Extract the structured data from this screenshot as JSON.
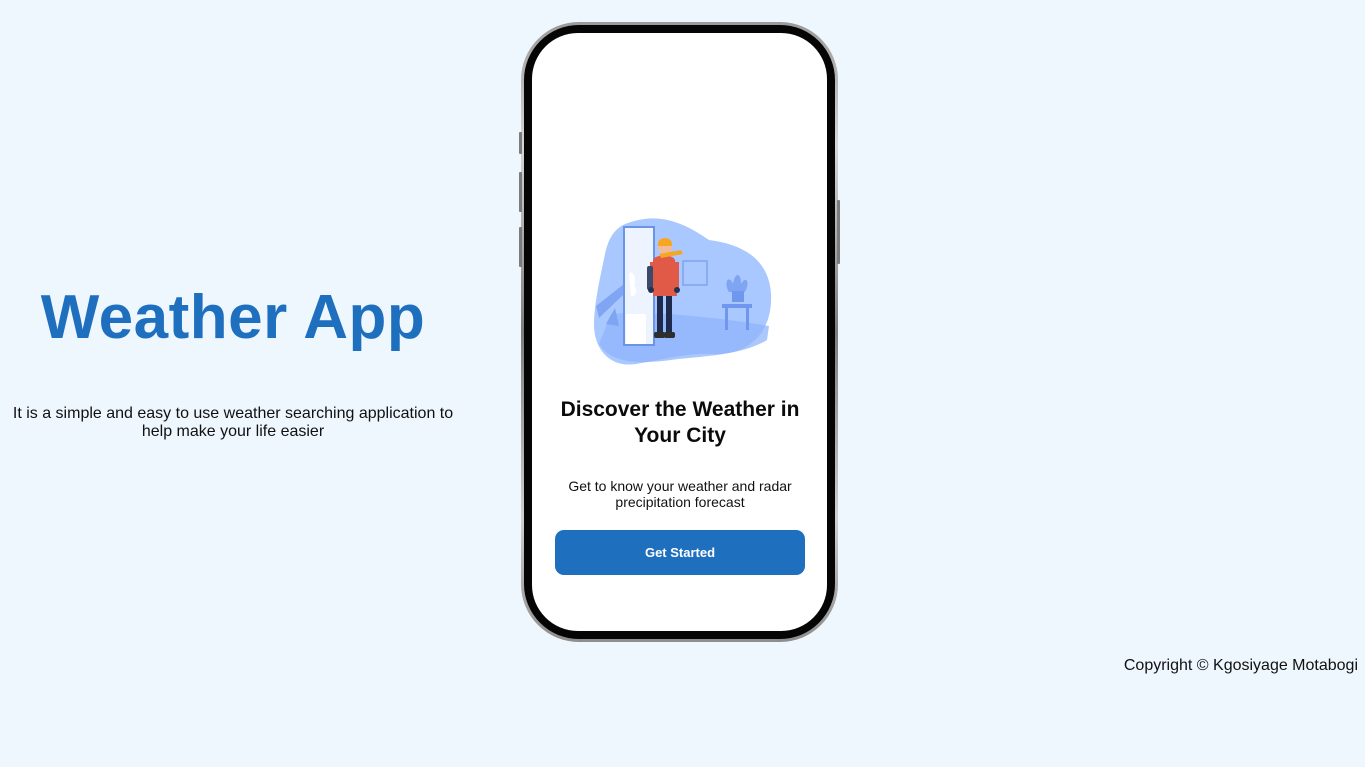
{
  "brand": {
    "title": "Weather App",
    "description": "It is a simple and easy to use weather searching application to help make your life easier"
  },
  "onboarding": {
    "heading": "Discover the Weather in Your City",
    "subheading": "Get to know your weather and radar precipitation forecast",
    "cta_label": "Get Started"
  },
  "footer": {
    "copyright": "Copyright © Kgosiyage Motabogi"
  },
  "colors": {
    "page_background": "#eef7fe",
    "accent": "#1f6fbf",
    "screen_background": "#ffffff",
    "illustration_blue": "#a9c8ff"
  },
  "icons": {
    "illustration": "person-at-snowy-door-illustration"
  }
}
